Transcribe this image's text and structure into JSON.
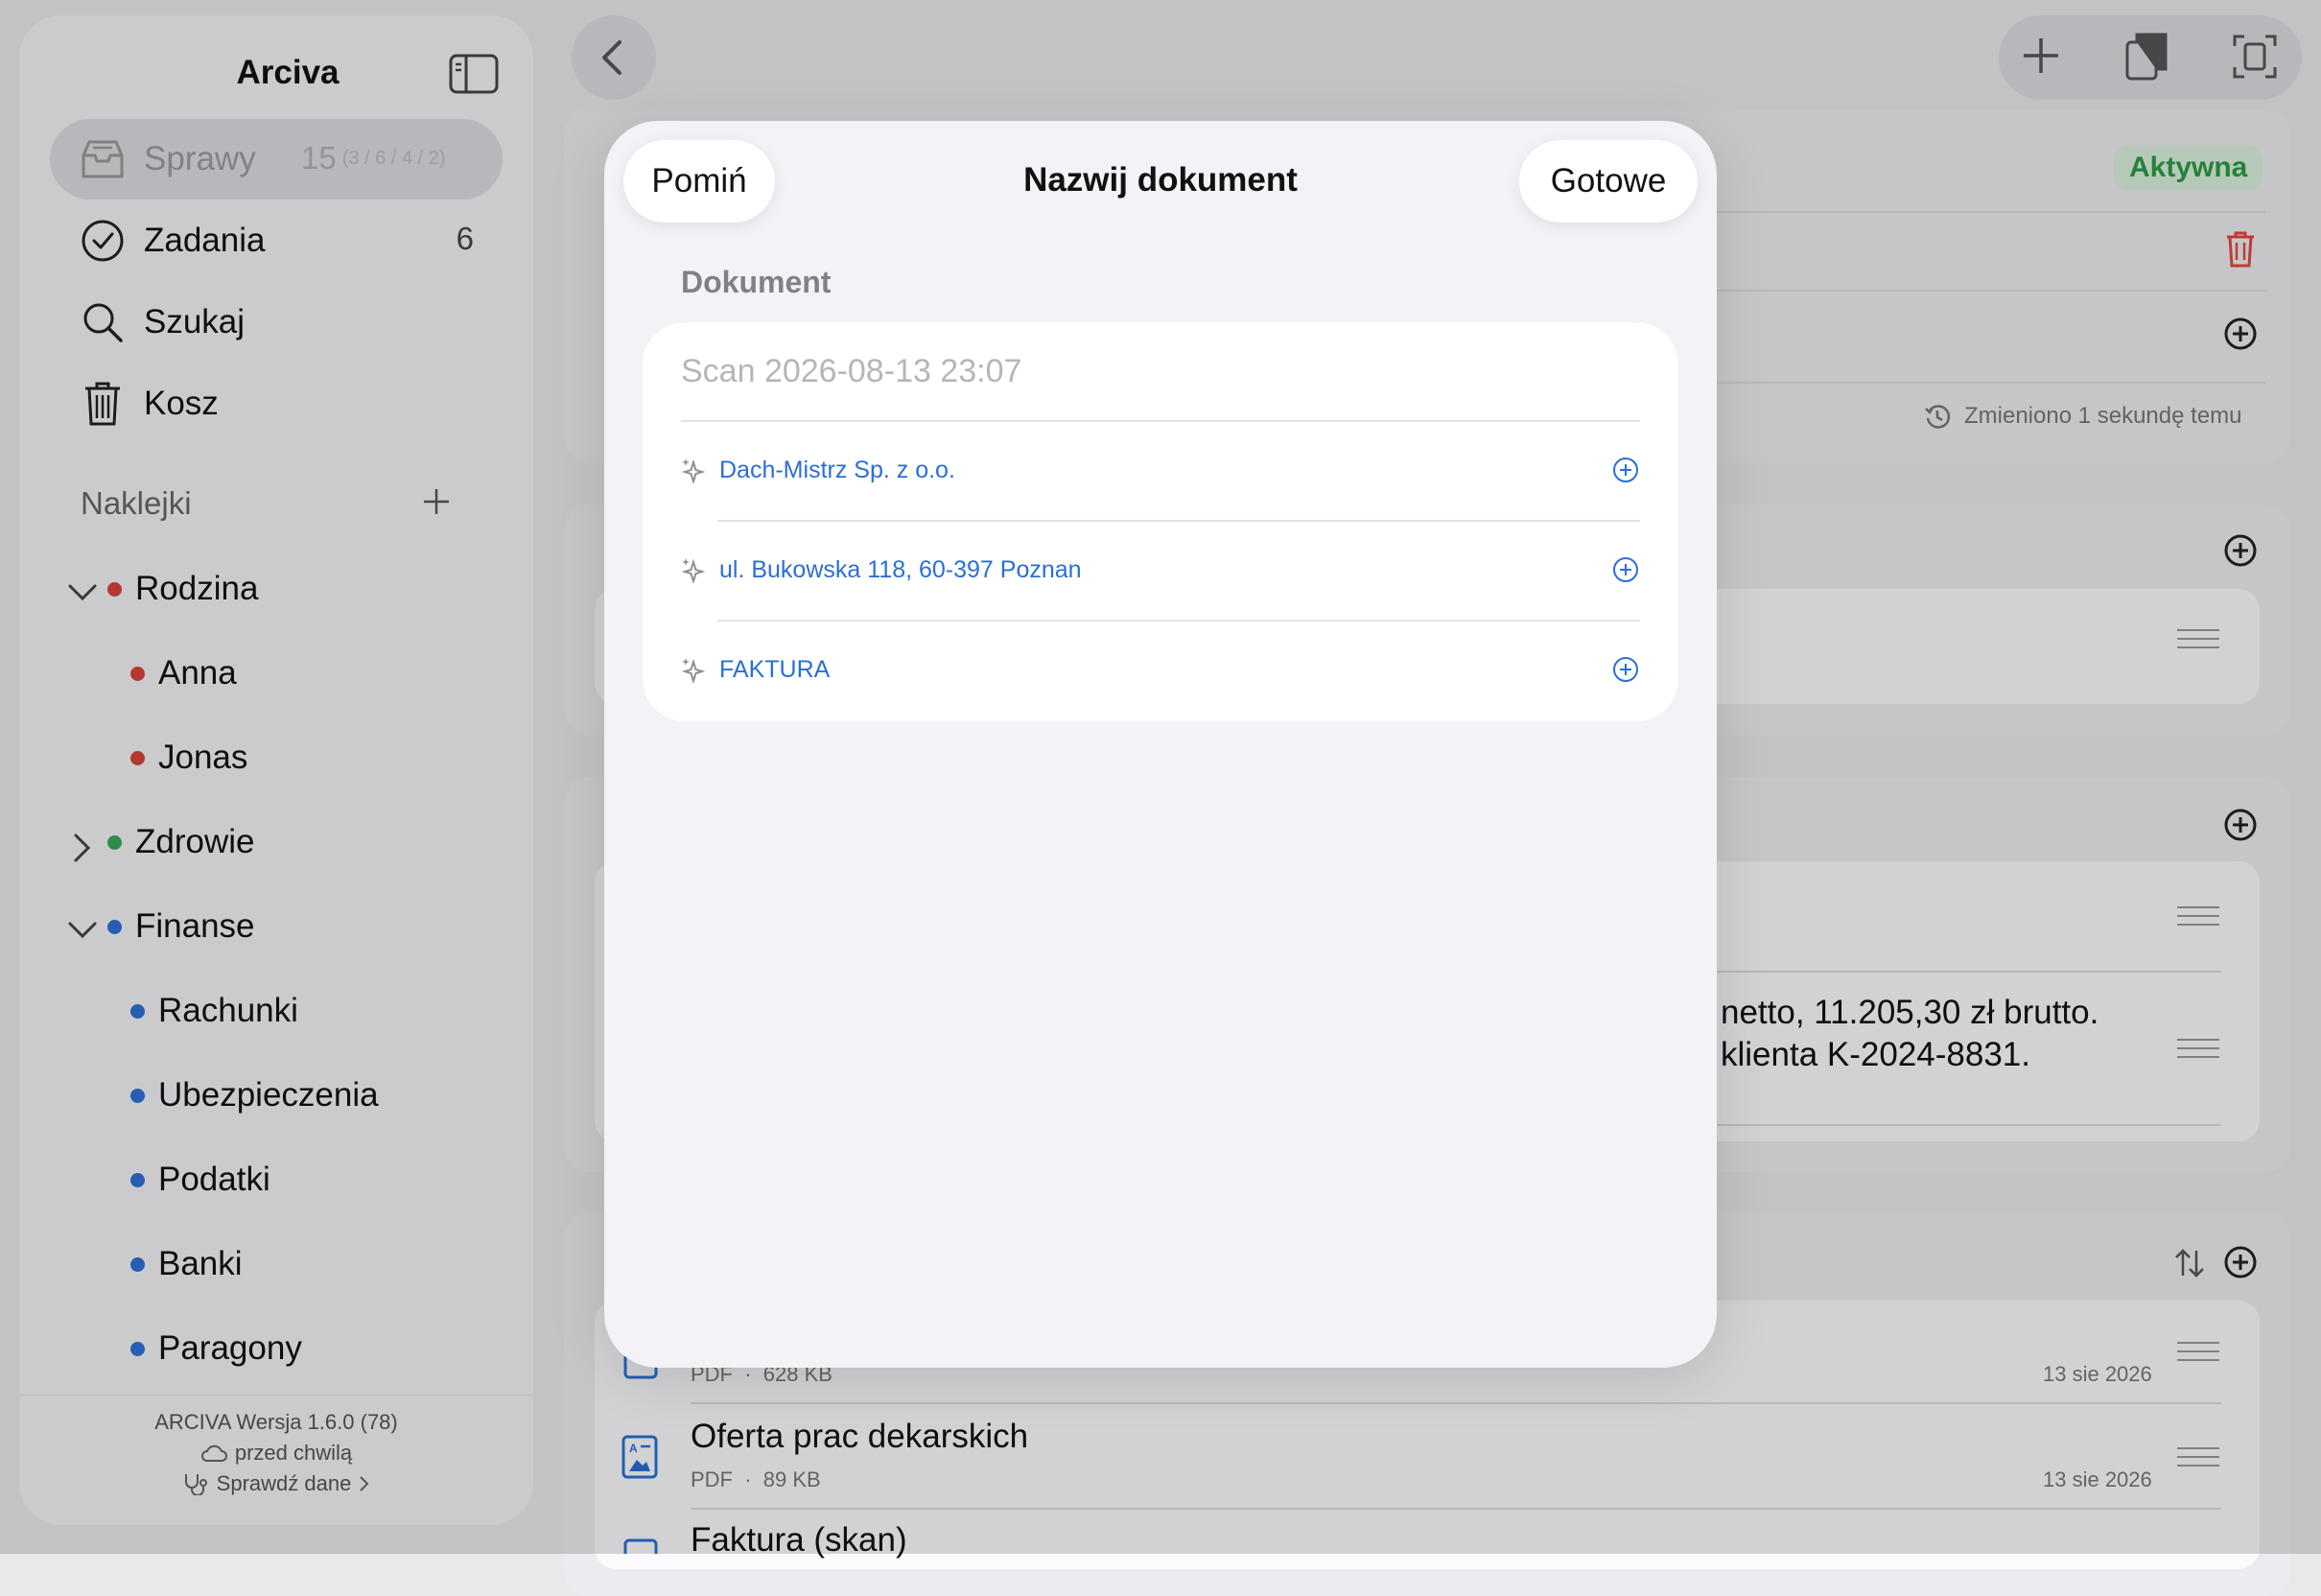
{
  "sidebar": {
    "title": "Arciva",
    "nav": [
      {
        "label": "Sprawy",
        "count": "15",
        "sub": "(3 / 6 / 4 / 2)"
      },
      {
        "label": "Zadania",
        "count": "6"
      },
      {
        "label": "Szukaj"
      },
      {
        "label": "Kosz"
      }
    ],
    "section": "Naklejki",
    "tags": [
      {
        "label": "Rodzina",
        "color": "#d6453a"
      },
      {
        "label": "Anna",
        "color": "#d6453a"
      },
      {
        "label": "Jonas",
        "color": "#d6453a"
      },
      {
        "label": "Zdrowie",
        "color": "#3aa757"
      },
      {
        "label": "Finanse",
        "color": "#2f6fd6"
      },
      {
        "label": "Rachunki",
        "color": "#2f6fd6"
      },
      {
        "label": "Ubezpieczenia",
        "color": "#2f6fd6"
      },
      {
        "label": "Podatki",
        "color": "#2f6fd6"
      },
      {
        "label": "Banki",
        "color": "#2f6fd6"
      },
      {
        "label": "Paragony",
        "color": "#2f6fd6"
      }
    ],
    "footer": {
      "version": "ARCIVA  Wersja 1.6.0 (78)",
      "sync": "przed chwilą",
      "check": "Sprawdź dane"
    }
  },
  "main": {
    "status_badge": "Aktywna",
    "changed": "Zmieniono 1 sekundę temu",
    "note_line1": "netto, 11.205,30 zł brutto.",
    "note_line2": "klienta K-2024-8831.",
    "documents": [
      {
        "title": "",
        "type": "PDF",
        "size": "628 KB",
        "date": "13 sie 2026"
      },
      {
        "title": "Oferta prac dekarskich",
        "type": "PDF",
        "size": "89 KB",
        "date": "13 sie 2026"
      },
      {
        "title": "Faktura (skan)"
      }
    ]
  },
  "modal": {
    "title": "Nazwij dokument",
    "skip": "Pomiń",
    "done": "Gotowe",
    "section_label": "Dokument",
    "input_placeholder": "Scan 2026-08-13 23:07",
    "suggestions": [
      "Dach-Mistrz Sp. z o.o.",
      "ul. Bukowska 118, 60-397 Poznan",
      "FAKTURA"
    ]
  },
  "colors": {
    "accent": "#2a6fd6",
    "active_green": "#2c9a46",
    "danger": "#e0483c"
  }
}
